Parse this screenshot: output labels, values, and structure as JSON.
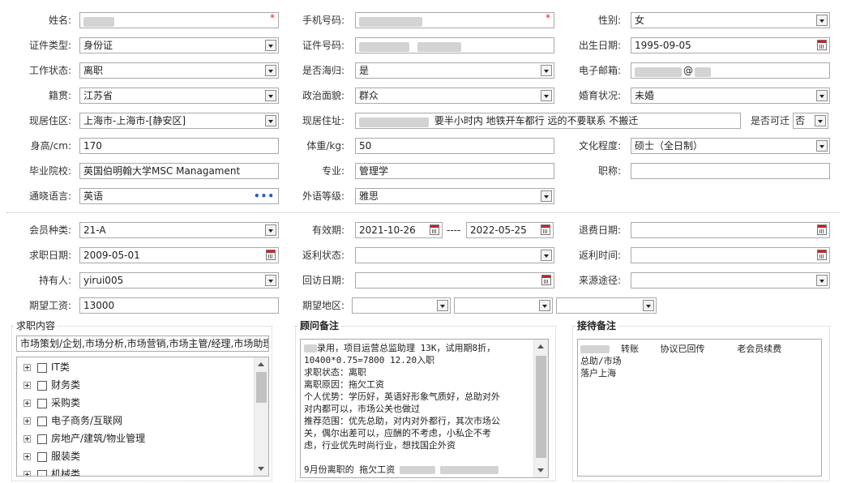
{
  "section1": {
    "name": {
      "label": "姓名:"
    },
    "phone": {
      "label": "手机号码:"
    },
    "gender": {
      "label": "性别:",
      "value": "女"
    },
    "id_type": {
      "label": "证件类型:",
      "value": "身份证"
    },
    "id_no": {
      "label": "证件号码:"
    },
    "birth": {
      "label": "出生日期:",
      "value": "1995-09-05"
    },
    "work_status": {
      "label": "工作状态:",
      "value": "离职"
    },
    "returnee": {
      "label": "是否海归:",
      "value": "是"
    },
    "email": {
      "label": "电子邮箱:",
      "value": "@"
    },
    "native": {
      "label": "籍贯:",
      "value": "江苏省"
    },
    "politics": {
      "label": "政治面貌:",
      "value": "群众"
    },
    "marital": {
      "label": "婚育状况:",
      "value": "未婚"
    },
    "residence_area": {
      "label": "现居住区:",
      "value": "上海市-上海市-[静安区]"
    },
    "address": {
      "label": "现居住址:",
      "value": "要半小时内 地铁开车都行 远的不要联系 不搬迁"
    },
    "relocate": {
      "label": "是否可迁",
      "value": "否"
    },
    "height": {
      "label": "身高/cm:",
      "value": "170"
    },
    "weight": {
      "label": "体重/kg:",
      "value": "50"
    },
    "education": {
      "label": "文化程度:",
      "value": "硕士（全日制）"
    },
    "school": {
      "label": "毕业院校:",
      "value": "英国伯明翰大学MSC Managament"
    },
    "major": {
      "label": "专业:",
      "value": "管理学"
    },
    "title": {
      "label": "职称:",
      "value": ""
    },
    "language": {
      "label": "通晓语言:",
      "value": "英语"
    },
    "lang_level": {
      "label": "外语等级:",
      "value": "雅思"
    }
  },
  "section2": {
    "member_type": {
      "label": "会员种类:",
      "value": "21-A"
    },
    "valid": {
      "label": "有效期:",
      "from": "2021-10-26",
      "sep": "----",
      "to": "2022-05-25"
    },
    "refund_date": {
      "label": "退费日期:",
      "value": ""
    },
    "apply_date": {
      "label": "求职日期:",
      "value": "2009-05-01"
    },
    "rebate_status": {
      "label": "返利状态:",
      "value": ""
    },
    "rebate_time": {
      "label": "返利时间:",
      "value": ""
    },
    "holder": {
      "label": "持有人:",
      "value": "yirui005"
    },
    "visit_date": {
      "label": "回访日期:",
      "value": ""
    },
    "source": {
      "label": "来源途径:",
      "value": ""
    },
    "salary": {
      "label": "期望工资:",
      "value": "13000"
    },
    "region": {
      "label": "期望地区:"
    }
  },
  "job_panel": {
    "title": "求职内容",
    "selected": "市场策划/企划,市场分析,市场营销,市场主管/经理,市场助理",
    "items": [
      "IT类",
      "财务类",
      "采购类",
      "电子商务/互联网",
      "房地产/建筑/物业管理",
      "服装类",
      "机械类"
    ]
  },
  "advisor_panel": {
    "title": "顾问备注",
    "lines": [
      "录用，项目运营总监助理 13K，试用期8折，",
      "10400*0.75=7800  12.20入职",
      "求职状态：离职",
      "离职原因：拖欠工资",
      "个人优势：学历好，英语好形象气质好，总助对外",
      "对内都可以，市场公关也做过",
      "推荐范围：优先总助，对内对外都行，其次市场公",
      "关，偶尔出差可以，应酬的不考虑，小私企不考",
      "虑，行业优先时尚行业，想找国企外资",
      "",
      "9月份离职的 拖欠工资"
    ]
  },
  "reception_panel": {
    "title": "接待备注",
    "lines": [
      "转账    协议已回传      老会员续费",
      "总助/市场",
      "落户上海"
    ]
  }
}
